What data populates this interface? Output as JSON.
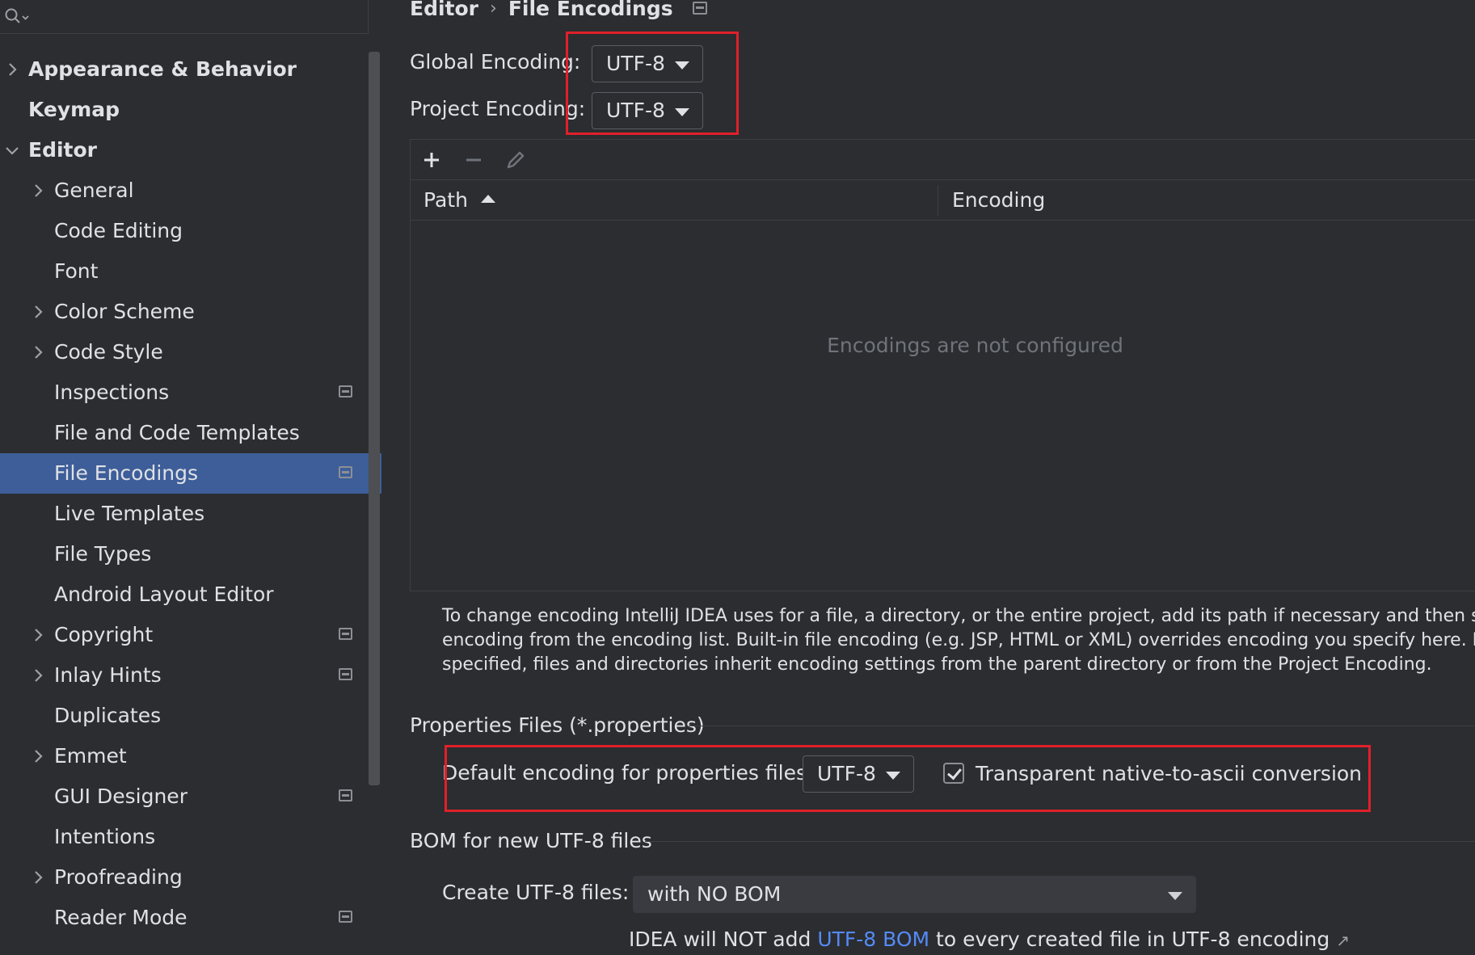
{
  "sidebar": {
    "search_placeholder": "",
    "items": [
      {
        "label": "Appearance & Behavior",
        "level": 0,
        "chevron": "right",
        "bold": true,
        "project_icon": false
      },
      {
        "label": "Keymap",
        "level": 0,
        "chevron": "none",
        "bold": true,
        "project_icon": false
      },
      {
        "label": "Editor",
        "level": 0,
        "chevron": "down",
        "bold": true,
        "project_icon": false
      },
      {
        "label": "General",
        "level": 1,
        "chevron": "right",
        "bold": false,
        "project_icon": false
      },
      {
        "label": "Code Editing",
        "level": 1,
        "chevron": "none",
        "bold": false,
        "project_icon": false
      },
      {
        "label": "Font",
        "level": 1,
        "chevron": "none",
        "bold": false,
        "project_icon": false
      },
      {
        "label": "Color Scheme",
        "level": 1,
        "chevron": "right",
        "bold": false,
        "project_icon": false
      },
      {
        "label": "Code Style",
        "level": 1,
        "chevron": "right",
        "bold": false,
        "project_icon": false
      },
      {
        "label": "Inspections",
        "level": 1,
        "chevron": "none",
        "bold": false,
        "project_icon": true
      },
      {
        "label": "File and Code Templates",
        "level": 1,
        "chevron": "none",
        "bold": false,
        "project_icon": false
      },
      {
        "label": "File Encodings",
        "level": 1,
        "chevron": "none",
        "bold": false,
        "project_icon": true,
        "selected": true
      },
      {
        "label": "Live Templates",
        "level": 1,
        "chevron": "none",
        "bold": false,
        "project_icon": false
      },
      {
        "label": "File Types",
        "level": 1,
        "chevron": "none",
        "bold": false,
        "project_icon": false
      },
      {
        "label": "Android Layout Editor",
        "level": 1,
        "chevron": "none",
        "bold": false,
        "project_icon": false
      },
      {
        "label": "Copyright",
        "level": 1,
        "chevron": "right",
        "bold": false,
        "project_icon": true
      },
      {
        "label": "Inlay Hints",
        "level": 1,
        "chevron": "right",
        "bold": false,
        "project_icon": true
      },
      {
        "label": "Duplicates",
        "level": 1,
        "chevron": "none",
        "bold": false,
        "project_icon": false
      },
      {
        "label": "Emmet",
        "level": 1,
        "chevron": "right",
        "bold": false,
        "project_icon": false
      },
      {
        "label": "GUI Designer",
        "level": 1,
        "chevron": "none",
        "bold": false,
        "project_icon": true
      },
      {
        "label": "Intentions",
        "level": 1,
        "chevron": "none",
        "bold": false,
        "project_icon": false
      },
      {
        "label": "Proofreading",
        "level": 1,
        "chevron": "right",
        "bold": false,
        "project_icon": false
      },
      {
        "label": "Reader Mode",
        "level": 1,
        "chevron": "none",
        "bold": false,
        "project_icon": true
      }
    ]
  },
  "breadcrumb": {
    "parent": "Editor",
    "separator": "›",
    "current": "File Encodings"
  },
  "encoding": {
    "global_label": "Global Encoding:",
    "global_value": "UTF-8",
    "project_label": "Project Encoding:",
    "project_value": "UTF-8"
  },
  "table": {
    "col_path": "Path",
    "col_encoding": "Encoding",
    "empty_text": "Encodings are not configured"
  },
  "help_lines": [
    "To change encoding IntelliJ IDEA uses for a file, a directory, or the entire project, add its path if necessary and then select",
    "encoding from the encoding list. Built-in file encoding (e.g. JSP, HTML or XML) overrides encoding you specify here. If no",
    "specified, files and directories inherit encoding settings from the parent directory or from the Project Encoding."
  ],
  "properties": {
    "section_title": "Properties Files (*.properties)",
    "default_label": "Default encoding for properties files:",
    "default_value": "UTF-8",
    "transparent_label": "Transparent native-to-ascii conversion",
    "transparent_checked": true
  },
  "bom": {
    "section_title": "BOM for new UTF-8 files",
    "create_label": "Create UTF-8 files:",
    "create_value": "with NO BOM",
    "info_prefix": "IDEA will NOT add ",
    "info_link": "UTF-8 BOM",
    "info_suffix": " to every created file in UTF-8 encoding",
    "info_ext": "↗"
  },
  "colors": {
    "background": "#2b2d30",
    "selection": "#3d5e99",
    "link": "#548af7",
    "highlight_box": "#e0202a"
  }
}
